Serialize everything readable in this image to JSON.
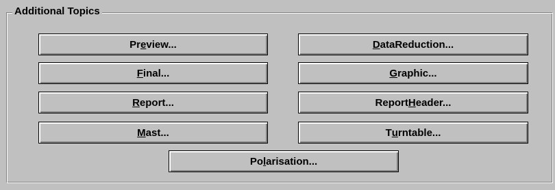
{
  "group": {
    "title": "Additional Topics"
  },
  "buttons": {
    "preview": {
      "before": "Pr",
      "mnemonic": "e",
      "after": "view..."
    },
    "data_reduction": {
      "before": "",
      "mnemonic": "D",
      "after": "ataReduction..."
    },
    "final": {
      "before": "",
      "mnemonic": "F",
      "after": "inal..."
    },
    "graphic": {
      "before": "",
      "mnemonic": "G",
      "after": "raphic..."
    },
    "report": {
      "before": "",
      "mnemonic": "R",
      "after": "eport..."
    },
    "report_header": {
      "before": "Report",
      "mnemonic": "H",
      "after": "eader..."
    },
    "mast": {
      "before": "",
      "mnemonic": "M",
      "after": "ast..."
    },
    "turntable": {
      "before": "T",
      "mnemonic": "u",
      "after": "rntable..."
    },
    "polarisation": {
      "before": "Po",
      "mnemonic": "l",
      "after": "arisation..."
    }
  }
}
